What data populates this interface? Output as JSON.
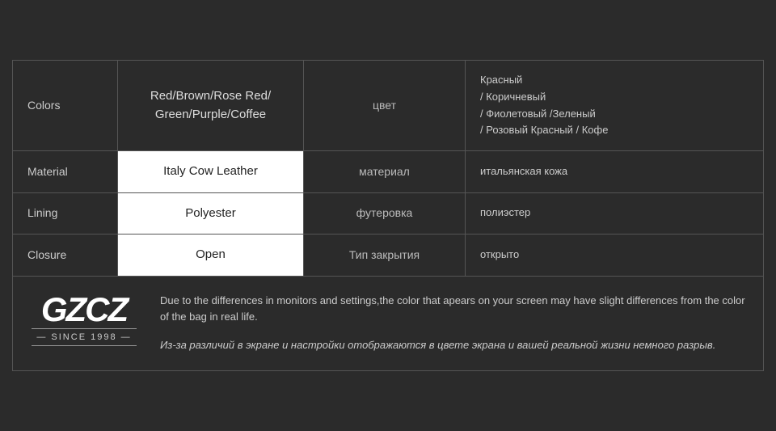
{
  "table": {
    "rows": [
      {
        "id": "colors",
        "label": "Colors",
        "en_value": "Red/Brown/Rose Red/\nGreen/Purple/Coffee",
        "ru_label": "цвет",
        "ru_value": "Красный\n/ Коричневый\n/ Фиолетовый /Зеленый\n/ Розовый Красный / Кофе"
      },
      {
        "id": "material",
        "label": "Material",
        "en_value": "Italy Cow Leather",
        "ru_label": "материал",
        "ru_value": "итальянская кожа"
      },
      {
        "id": "lining",
        "label": "Lining",
        "en_value": "Polyester",
        "ru_label": "футеровка",
        "ru_value": "полиэстер"
      },
      {
        "id": "closure",
        "label": "Closure",
        "en_value": "Open",
        "ru_label": "Тип закрытия",
        "ru_value": "открыто"
      }
    ],
    "footer": {
      "logo_text": "GZCZ",
      "logo_sub": "— SINCE 1998 —",
      "notice_en": "Due to the differences in monitors and settings,the color that apears on your screen may have slight differences from the color of the bag in real life.",
      "notice_ru": "Из-за различий в экране и настройки отображаются в цвете экрана и вашей реальной жизни немного разрыв."
    }
  }
}
